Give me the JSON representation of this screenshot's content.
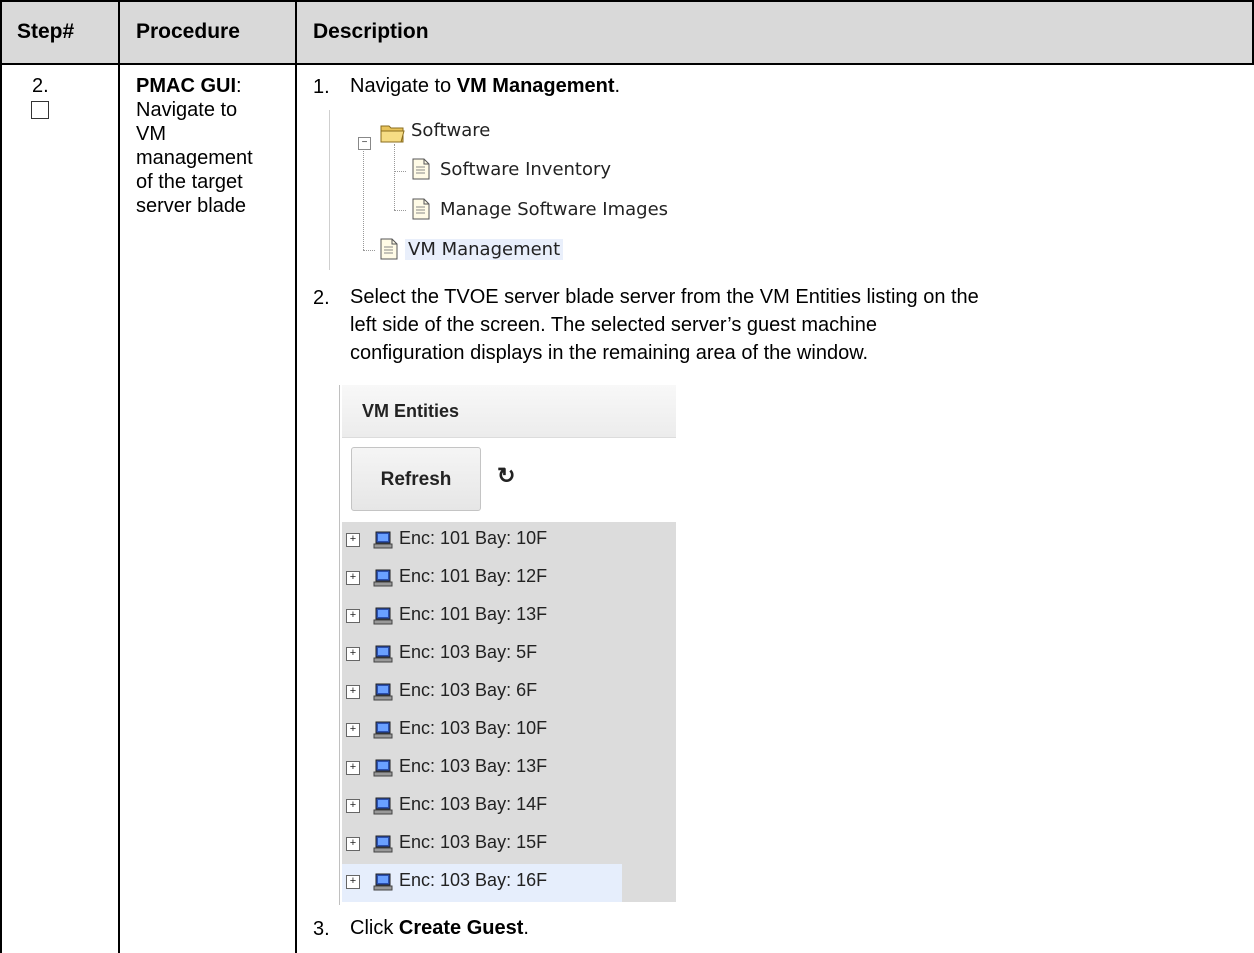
{
  "header": {
    "col_step": "Step#",
    "col_procedure": "Procedure",
    "col_description": "Description"
  },
  "row": {
    "step": "2.",
    "procedure_title": "PMAC GUI",
    "procedure_colon": ":",
    "procedure_lines": [
      "Navigate to",
      "VM",
      "management",
      "of the target",
      "server blade"
    ],
    "steps": [
      {
        "num": "1.",
        "prefix": "Navigate to ",
        "bold": "VM Management",
        "suffix": "."
      },
      {
        "num": "2.",
        "lines": [
          "Select the TVOE server blade server from the VM Entities listing on the",
          "left side of the screen.  The selected server’s guest machine",
          "configuration displays in the remaining area of the window."
        ]
      },
      {
        "num": "3.",
        "prefix": "Click ",
        "bold": "Create Guest",
        "suffix": "."
      }
    ]
  },
  "nav_tree": {
    "folder_label": "Software",
    "children": [
      "Software Inventory",
      "Manage Software Images"
    ],
    "vm_management": "VM Management",
    "icons": [
      "folder-open-icon",
      "document-icon"
    ]
  },
  "vm_entities": {
    "title": "VM Entities",
    "refresh_label": "Refresh",
    "refresh_icon": "↻",
    "items": [
      "Enc: 101 Bay: 10F",
      "Enc: 101 Bay: 12F",
      "Enc: 101 Bay: 13F",
      "Enc: 103 Bay: 5F",
      "Enc: 103 Bay: 6F",
      "Enc: 103 Bay: 10F",
      "Enc: 103 Bay: 13F",
      "Enc: 103 Bay: 14F",
      "Enc: 103 Bay: 15F",
      "Enc: 103 Bay: 16F"
    ],
    "selected_index": 9,
    "colors": {
      "list_bg": "#dcdcdc",
      "selected_bg": "#e6eefc",
      "header_bg": "#d9d9d9"
    }
  }
}
